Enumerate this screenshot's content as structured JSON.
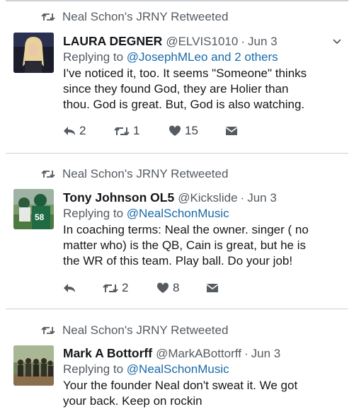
{
  "tweets": [
    {
      "retweeted_by": "Neal Schon's JRNY Retweeted",
      "name": "LAURA DEGNER",
      "handle": "@ELVIS1010",
      "date": "Jun 3",
      "reply_prefix": "Replying to",
      "reply_to": "@JosephMLeo and 2 others",
      "lines": [
        "I've noticed it, too.  It seems \"Someone\" thinks",
        "since they found God, they are Holier than",
        "thou.  God is great.  But, God is also watching."
      ],
      "replies": "2",
      "retweets": "1",
      "likes": "15"
    },
    {
      "retweeted_by": "Neal Schon's JRNY Retweeted",
      "name": "Tony Johnson OL5",
      "handle": "@Kickslide",
      "date": "Jun 3",
      "reply_prefix": "Replying to",
      "reply_to": "@NealSchonMusic",
      "lines": [
        "In coaching terms: Neal the owner. singer ( no",
        "matter who) is the QB, Cain is great, but he is",
        "the WR of this team. Play ball. Do your job!"
      ],
      "replies": "",
      "retweets": "2",
      "likes": "8"
    },
    {
      "retweeted_by": "Neal Schon's JRNY Retweeted",
      "name": "Mark A Bottorff",
      "handle": "@MarkABottorff",
      "date": "Jun 3",
      "reply_prefix": "Replying to",
      "reply_to": "@NealSchonMusic",
      "lines": [
        "Your the founder Neal don't sweat it. We got",
        "your back. Keep on rockin"
      ]
    }
  ],
  "separator": "·",
  "colors": {
    "link": "#1a6aa8",
    "muted": "#555b61",
    "text": "#14171a",
    "divider": "#cdd1d6"
  }
}
